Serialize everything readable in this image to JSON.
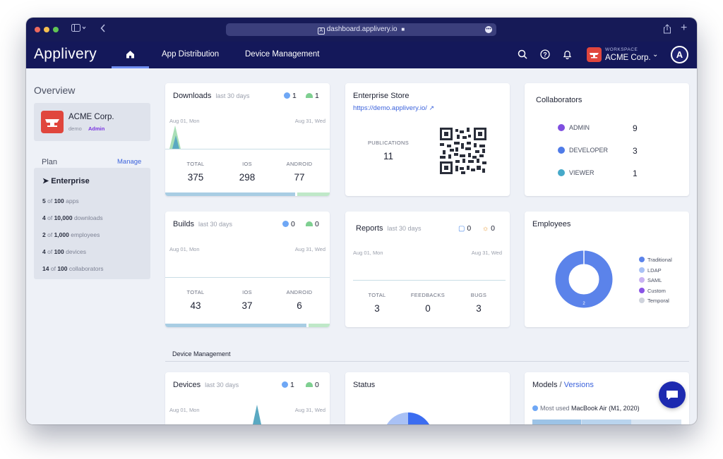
{
  "browser": {
    "url": "dashboard.applivery.io"
  },
  "nav": {
    "logo": "Applivery",
    "links": [
      "App Distribution",
      "Device Management"
    ],
    "workspace_label": "WORKSPACE",
    "workspace_name": "ACME Corp."
  },
  "sidebar": {
    "title": "Overview",
    "org_name": "ACME Corp.",
    "org_slug": "demo",
    "org_role": "Admin",
    "plan_label": "Plan",
    "plan_manage": "Manage",
    "plan_name": "Enterprise",
    "plan_items": [
      {
        "used": "5",
        "of": "of",
        "limit": "100",
        "unit": "apps"
      },
      {
        "used": "4",
        "of": "of",
        "limit": "10,000",
        "unit": "downloads"
      },
      {
        "used": "2",
        "of": "of",
        "limit": "1,000",
        "unit": "employees"
      },
      {
        "used": "4",
        "of": "of",
        "limit": "100",
        "unit": "devices"
      },
      {
        "used": "14",
        "of": "of",
        "limit": "100",
        "unit": "collaborators"
      }
    ]
  },
  "downloads": {
    "title": "Downloads",
    "period": "last 30 days",
    "ios_count": "1",
    "android_count": "1",
    "date_start": "Aug 01, Mon",
    "date_end": "Aug 31, Wed",
    "stats": [
      {
        "label": "TOTAL",
        "value": "375"
      },
      {
        "label": "IOS",
        "value": "298"
      },
      {
        "label": "ANDROID",
        "value": "77"
      }
    ],
    "ios_share": 0.79
  },
  "store": {
    "title": "Enterprise Store",
    "link": "https://demo.applivery.io/",
    "pub_label": "PUBLICATIONS",
    "pub_value": "11"
  },
  "collaborators": {
    "title": "Collaborators",
    "rows": [
      {
        "role": "ADMIN",
        "count": "9",
        "color": "#7f4fe0"
      },
      {
        "role": "DEVELOPER",
        "count": "3",
        "color": "#4f7be8"
      },
      {
        "role": "VIEWER",
        "count": "1",
        "color": "#46a9c9"
      }
    ]
  },
  "builds": {
    "title": "Builds",
    "period": "last 30 days",
    "ios_count": "0",
    "android_count": "0",
    "date_start": "Aug 01, Mon",
    "date_end": "Aug 31, Wed",
    "stats": [
      {
        "label": "TOTAL",
        "value": "43"
      },
      {
        "label": "IOS",
        "value": "37"
      },
      {
        "label": "ANDROID",
        "value": "6"
      }
    ],
    "ios_share": 0.86
  },
  "reports": {
    "title": "Reports",
    "period": "last 30 days",
    "feedback_count": "0",
    "bug_count": "0",
    "date_start": "Aug 01, Mon",
    "date_end": "Aug 31, Wed",
    "stats": [
      {
        "label": "TOTAL",
        "value": "3"
      },
      {
        "label": "FEEDBACKS",
        "value": "0"
      },
      {
        "label": "BUGS",
        "value": "3"
      }
    ]
  },
  "employees": {
    "title": "Employees",
    "donut_value": "2",
    "legend": [
      {
        "name": "Traditional",
        "color": "#5b83ea"
      },
      {
        "name": "LDAP",
        "color": "#a9c1f5"
      },
      {
        "name": "SAML",
        "color": "#c9b3f2"
      },
      {
        "name": "Custom",
        "color": "#8a55e6"
      },
      {
        "name": "Temporal",
        "color": "#cfd3dc"
      }
    ]
  },
  "device_section": {
    "title": "Device Management"
  },
  "devices": {
    "title": "Devices",
    "period": "last 30 days",
    "ios_count": "1",
    "android_count": "0",
    "date_start": "Aug 01, Mon",
    "date_end": "Aug 31, Wed"
  },
  "status": {
    "title": "Status"
  },
  "models": {
    "title": "Models",
    "separator": "/",
    "versions": "Versions",
    "most_used_label": "Most used",
    "most_used_value": "MacBook Air (M1, 2020)"
  },
  "colors": {
    "navy": "#14185a",
    "accent": "#3c63dc",
    "ios": "#6ea7f5",
    "android": "#7fcf91",
    "brand_red": "#e0463d"
  }
}
